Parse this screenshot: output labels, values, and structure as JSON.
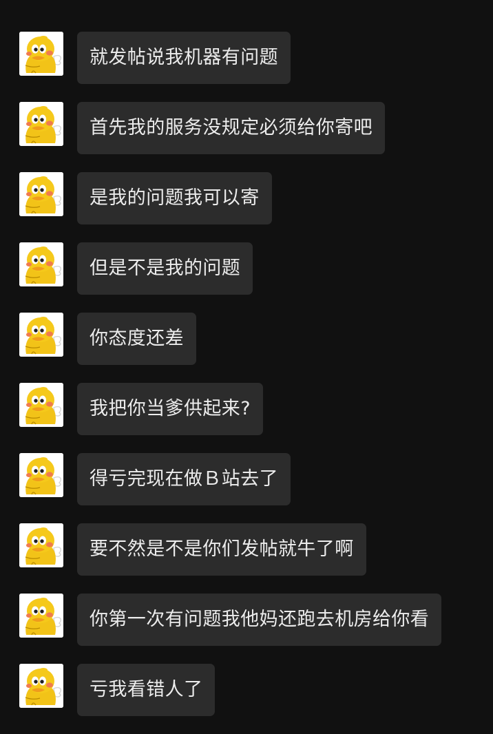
{
  "conversation": {
    "avatar_icon": "yellow-penguin-avatar-icon",
    "colors": {
      "background": "#111111",
      "bubble": "#2c2c2c",
      "text": "#ececec"
    },
    "messages": [
      {
        "text": "就发帖说我机器有问题"
      },
      {
        "text": "首先我的服务没规定必须给你寄吧"
      },
      {
        "text": "是我的问题我可以寄"
      },
      {
        "text": "但是不是我的问题"
      },
      {
        "text": "你态度还差"
      },
      {
        "text": "我把你当爹供起来?"
      },
      {
        "text": "得亏完现在做Ｂ站去了"
      },
      {
        "text": "要不然是不是你们发帖就牛了啊"
      },
      {
        "text": "你第一次有问题我他妈还跑去机房给你看"
      },
      {
        "text": "亏我看错人了"
      }
    ]
  }
}
